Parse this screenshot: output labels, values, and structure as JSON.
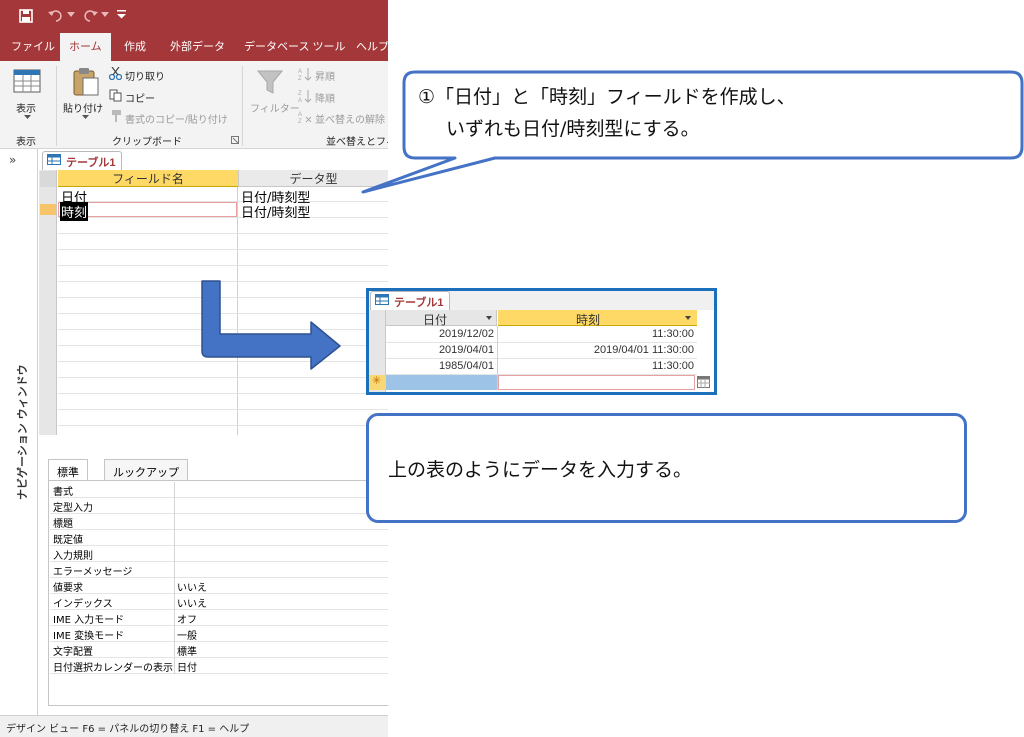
{
  "titlebar": {
    "save_icon": "save-icon",
    "undo_icon": "undo-icon",
    "redo_icon": "redo-icon",
    "customize_icon": "customize-qat-icon"
  },
  "ribbon_tabs": [
    "ファイル",
    "ホーム",
    "作成",
    "外部データ",
    "データベース ツール",
    "ヘルプ"
  ],
  "ribbon": {
    "view_label": "表示",
    "view_group": "表示",
    "paste_label": "貼り付け",
    "cut_label": "切り取り",
    "copy_label": "コピー",
    "format_painter_label": "書式のコピー/貼り付け",
    "clipboard_group": "クリップボード",
    "filter_label": "フィルター",
    "ascending_label": "昇順",
    "descending_label": "降順",
    "remove_sort_label": "並べ替えの解除",
    "sort_group": "並べ替えとフィ"
  },
  "navpane": {
    "chevron": "»",
    "label": "ナビゲーション ウィンドウ"
  },
  "design": {
    "tab_label": "テーブル1",
    "col_field": "フィールド名",
    "col_type": "データ型",
    "rows": [
      {
        "field": "日付",
        "type": "日付/時刻型"
      },
      {
        "field": "時刻",
        "type": "日付/時刻型"
      }
    ]
  },
  "properties": {
    "tabs": [
      "標準",
      "ルックアップ"
    ],
    "rows": [
      {
        "name": "書式",
        "value": ""
      },
      {
        "name": "定型入力",
        "value": ""
      },
      {
        "name": "標題",
        "value": ""
      },
      {
        "name": "既定値",
        "value": ""
      },
      {
        "name": "入力規則",
        "value": ""
      },
      {
        "name": "エラーメッセージ",
        "value": ""
      },
      {
        "name": "値要求",
        "value": "いいえ"
      },
      {
        "name": "インデックス",
        "value": "いいえ"
      },
      {
        "name": "IME 入力モード",
        "value": "オフ"
      },
      {
        "name": "IME 変換モード",
        "value": "一般"
      },
      {
        "name": "文字配置",
        "value": "標準"
      },
      {
        "name": "日付選択カレンダーの表示",
        "value": "日付"
      }
    ]
  },
  "statusbar": {
    "text": "デザイン ビュー   F6 = パネルの切り替え   F1 = ヘルプ"
  },
  "callout1": {
    "line1": "①「日付」と「時刻」フィールドを作成し、",
    "line2": "いずれも日付/時刻型にする。"
  },
  "callout2": {
    "text": "上の表のようにデータを入力する。"
  },
  "datasheet": {
    "tab_label": "テーブル1",
    "col1": "日付",
    "col2": "時刻",
    "rows": [
      {
        "date": "2019/12/02",
        "time": "11:30:00"
      },
      {
        "date": "2019/04/01",
        "time": "2019/04/01 11:30:00"
      },
      {
        "date": "1985/04/01",
        "time": "11:30:00"
      }
    ],
    "new_row_marker": "✳"
  },
  "colors": {
    "access_red": "#a4373a",
    "callout_blue": "#4472c4",
    "arrow_blue": "#4472c4",
    "header_yellow": "#ffd966"
  }
}
